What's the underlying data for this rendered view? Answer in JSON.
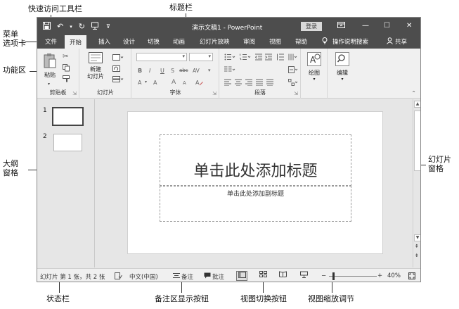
{
  "annotations": {
    "quick_access": "快速访问工具栏",
    "title_bar": "标题栏",
    "menu_tabs": "菜单\n选项卡",
    "ribbon": "功能区",
    "outline_pane": "大纲\n窗格",
    "slide_pane": "幻灯片\n窗格",
    "status_bar": "状态栏",
    "notes_button": "备注区显示按钮",
    "view_switch": "视图切换按钮",
    "zoom_adjust": "视图缩放调节"
  },
  "titlebar": {
    "title": "演示文稿1 - PowerPoint",
    "login": "登录",
    "icons": [
      "save-icon",
      "undo-icon",
      "redo-icon",
      "start-from-beginning-icon",
      "customize-icon"
    ],
    "window_icons": [
      "ribbon-display-icon",
      "minimize-icon",
      "maximize-icon",
      "close-icon"
    ]
  },
  "menu": {
    "tabs": [
      "文件",
      "开始",
      "插入",
      "设计",
      "切换",
      "动画",
      "幻灯片放映",
      "审阅",
      "视图",
      "帮助"
    ],
    "active_index": 1,
    "tell_me": "操作说明搜索",
    "share": "共享"
  },
  "ribbon": {
    "groups": [
      "剪贴板",
      "幻灯片",
      "字体",
      "段落",
      "绘图",
      "编辑"
    ],
    "paste": "粘贴",
    "new_slide": "新建\n幻灯片",
    "drawing": "绘图",
    "editing": "编辑",
    "font_buttons": [
      "B",
      "I",
      "U",
      "S",
      "abc",
      "AV"
    ],
    "font_size_buttons": [
      "A",
      "A",
      "A",
      "A"
    ]
  },
  "thumbnails": [
    {
      "number": "1",
      "selected": true
    },
    {
      "number": "2",
      "selected": false
    }
  ],
  "slide": {
    "title_placeholder": "单击此处添加标题",
    "subtitle_placeholder": "单击此处添加副标题"
  },
  "status": {
    "slide_info": "幻灯片 第 1 张，共 2 张",
    "language": "中文(中国)",
    "notes": "备注",
    "comments": "批注",
    "zoom_minus": "−",
    "zoom_plus": "+",
    "zoom": "40%",
    "zoom_fraction": 0.4
  }
}
